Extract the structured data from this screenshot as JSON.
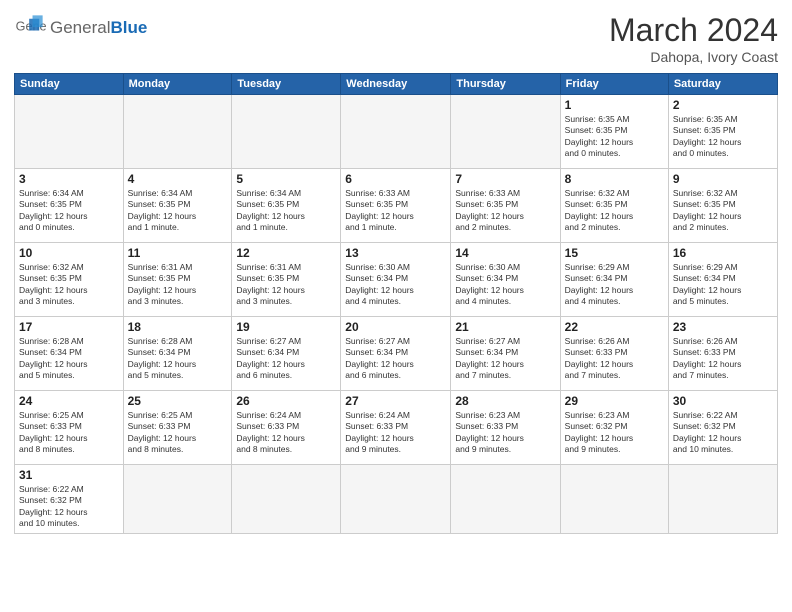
{
  "header": {
    "logo_general": "General",
    "logo_blue": "Blue",
    "title": "March 2024",
    "location": "Dahopa, Ivory Coast"
  },
  "weekdays": [
    "Sunday",
    "Monday",
    "Tuesday",
    "Wednesday",
    "Thursday",
    "Friday",
    "Saturday"
  ],
  "weeks": [
    [
      {
        "day": "",
        "info": ""
      },
      {
        "day": "",
        "info": ""
      },
      {
        "day": "",
        "info": ""
      },
      {
        "day": "",
        "info": ""
      },
      {
        "day": "",
        "info": ""
      },
      {
        "day": "1",
        "info": "Sunrise: 6:35 AM\nSunset: 6:35 PM\nDaylight: 12 hours\nand 0 minutes."
      },
      {
        "day": "2",
        "info": "Sunrise: 6:35 AM\nSunset: 6:35 PM\nDaylight: 12 hours\nand 0 minutes."
      }
    ],
    [
      {
        "day": "3",
        "info": "Sunrise: 6:34 AM\nSunset: 6:35 PM\nDaylight: 12 hours\nand 0 minutes."
      },
      {
        "day": "4",
        "info": "Sunrise: 6:34 AM\nSunset: 6:35 PM\nDaylight: 12 hours\nand 1 minute."
      },
      {
        "day": "5",
        "info": "Sunrise: 6:34 AM\nSunset: 6:35 PM\nDaylight: 12 hours\nand 1 minute."
      },
      {
        "day": "6",
        "info": "Sunrise: 6:33 AM\nSunset: 6:35 PM\nDaylight: 12 hours\nand 1 minute."
      },
      {
        "day": "7",
        "info": "Sunrise: 6:33 AM\nSunset: 6:35 PM\nDaylight: 12 hours\nand 2 minutes."
      },
      {
        "day": "8",
        "info": "Sunrise: 6:32 AM\nSunset: 6:35 PM\nDaylight: 12 hours\nand 2 minutes."
      },
      {
        "day": "9",
        "info": "Sunrise: 6:32 AM\nSunset: 6:35 PM\nDaylight: 12 hours\nand 2 minutes."
      }
    ],
    [
      {
        "day": "10",
        "info": "Sunrise: 6:32 AM\nSunset: 6:35 PM\nDaylight: 12 hours\nand 3 minutes."
      },
      {
        "day": "11",
        "info": "Sunrise: 6:31 AM\nSunset: 6:35 PM\nDaylight: 12 hours\nand 3 minutes."
      },
      {
        "day": "12",
        "info": "Sunrise: 6:31 AM\nSunset: 6:35 PM\nDaylight: 12 hours\nand 3 minutes."
      },
      {
        "day": "13",
        "info": "Sunrise: 6:30 AM\nSunset: 6:34 PM\nDaylight: 12 hours\nand 4 minutes."
      },
      {
        "day": "14",
        "info": "Sunrise: 6:30 AM\nSunset: 6:34 PM\nDaylight: 12 hours\nand 4 minutes."
      },
      {
        "day": "15",
        "info": "Sunrise: 6:29 AM\nSunset: 6:34 PM\nDaylight: 12 hours\nand 4 minutes."
      },
      {
        "day": "16",
        "info": "Sunrise: 6:29 AM\nSunset: 6:34 PM\nDaylight: 12 hours\nand 5 minutes."
      }
    ],
    [
      {
        "day": "17",
        "info": "Sunrise: 6:28 AM\nSunset: 6:34 PM\nDaylight: 12 hours\nand 5 minutes."
      },
      {
        "day": "18",
        "info": "Sunrise: 6:28 AM\nSunset: 6:34 PM\nDaylight: 12 hours\nand 5 minutes."
      },
      {
        "day": "19",
        "info": "Sunrise: 6:27 AM\nSunset: 6:34 PM\nDaylight: 12 hours\nand 6 minutes."
      },
      {
        "day": "20",
        "info": "Sunrise: 6:27 AM\nSunset: 6:34 PM\nDaylight: 12 hours\nand 6 minutes."
      },
      {
        "day": "21",
        "info": "Sunrise: 6:27 AM\nSunset: 6:34 PM\nDaylight: 12 hours\nand 7 minutes."
      },
      {
        "day": "22",
        "info": "Sunrise: 6:26 AM\nSunset: 6:33 PM\nDaylight: 12 hours\nand 7 minutes."
      },
      {
        "day": "23",
        "info": "Sunrise: 6:26 AM\nSunset: 6:33 PM\nDaylight: 12 hours\nand 7 minutes."
      }
    ],
    [
      {
        "day": "24",
        "info": "Sunrise: 6:25 AM\nSunset: 6:33 PM\nDaylight: 12 hours\nand 8 minutes."
      },
      {
        "day": "25",
        "info": "Sunrise: 6:25 AM\nSunset: 6:33 PM\nDaylight: 12 hours\nand 8 minutes."
      },
      {
        "day": "26",
        "info": "Sunrise: 6:24 AM\nSunset: 6:33 PM\nDaylight: 12 hours\nand 8 minutes."
      },
      {
        "day": "27",
        "info": "Sunrise: 6:24 AM\nSunset: 6:33 PM\nDaylight: 12 hours\nand 9 minutes."
      },
      {
        "day": "28",
        "info": "Sunrise: 6:23 AM\nSunset: 6:33 PM\nDaylight: 12 hours\nand 9 minutes."
      },
      {
        "day": "29",
        "info": "Sunrise: 6:23 AM\nSunset: 6:32 PM\nDaylight: 12 hours\nand 9 minutes."
      },
      {
        "day": "30",
        "info": "Sunrise: 6:22 AM\nSunset: 6:32 PM\nDaylight: 12 hours\nand 10 minutes."
      }
    ],
    [
      {
        "day": "31",
        "info": "Sunrise: 6:22 AM\nSunset: 6:32 PM\nDaylight: 12 hours\nand 10 minutes."
      },
      {
        "day": "",
        "info": ""
      },
      {
        "day": "",
        "info": ""
      },
      {
        "day": "",
        "info": ""
      },
      {
        "day": "",
        "info": ""
      },
      {
        "day": "",
        "info": ""
      },
      {
        "day": "",
        "info": ""
      }
    ]
  ]
}
